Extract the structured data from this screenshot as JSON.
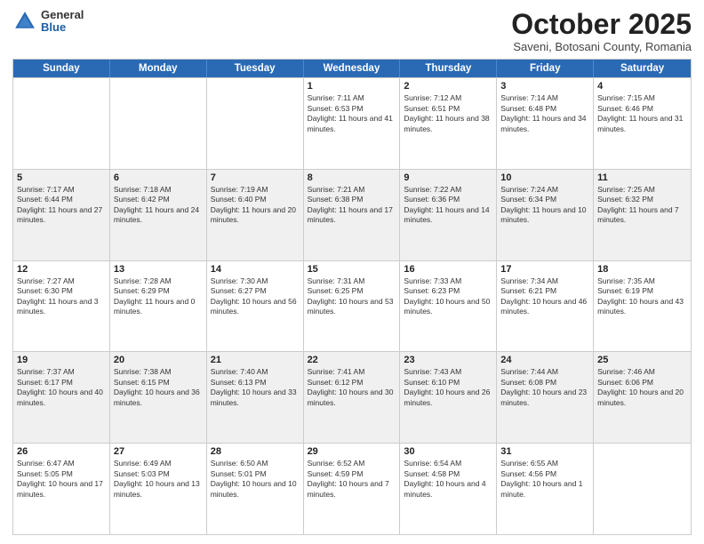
{
  "header": {
    "logo": {
      "general": "General",
      "blue": "Blue"
    },
    "title": "October 2025",
    "location": "Saveni, Botosani County, Romania"
  },
  "weekdays": [
    "Sunday",
    "Monday",
    "Tuesday",
    "Wednesday",
    "Thursday",
    "Friday",
    "Saturday"
  ],
  "rows": [
    [
      {
        "day": "",
        "info": ""
      },
      {
        "day": "",
        "info": ""
      },
      {
        "day": "",
        "info": ""
      },
      {
        "day": "1",
        "info": "Sunrise: 7:11 AM\nSunset: 6:53 PM\nDaylight: 11 hours and 41 minutes."
      },
      {
        "day": "2",
        "info": "Sunrise: 7:12 AM\nSunset: 6:51 PM\nDaylight: 11 hours and 38 minutes."
      },
      {
        "day": "3",
        "info": "Sunrise: 7:14 AM\nSunset: 6:48 PM\nDaylight: 11 hours and 34 minutes."
      },
      {
        "day": "4",
        "info": "Sunrise: 7:15 AM\nSunset: 6:46 PM\nDaylight: 11 hours and 31 minutes."
      }
    ],
    [
      {
        "day": "5",
        "info": "Sunrise: 7:17 AM\nSunset: 6:44 PM\nDaylight: 11 hours and 27 minutes."
      },
      {
        "day": "6",
        "info": "Sunrise: 7:18 AM\nSunset: 6:42 PM\nDaylight: 11 hours and 24 minutes."
      },
      {
        "day": "7",
        "info": "Sunrise: 7:19 AM\nSunset: 6:40 PM\nDaylight: 11 hours and 20 minutes."
      },
      {
        "day": "8",
        "info": "Sunrise: 7:21 AM\nSunset: 6:38 PM\nDaylight: 11 hours and 17 minutes."
      },
      {
        "day": "9",
        "info": "Sunrise: 7:22 AM\nSunset: 6:36 PM\nDaylight: 11 hours and 14 minutes."
      },
      {
        "day": "10",
        "info": "Sunrise: 7:24 AM\nSunset: 6:34 PM\nDaylight: 11 hours and 10 minutes."
      },
      {
        "day": "11",
        "info": "Sunrise: 7:25 AM\nSunset: 6:32 PM\nDaylight: 11 hours and 7 minutes."
      }
    ],
    [
      {
        "day": "12",
        "info": "Sunrise: 7:27 AM\nSunset: 6:30 PM\nDaylight: 11 hours and 3 minutes."
      },
      {
        "day": "13",
        "info": "Sunrise: 7:28 AM\nSunset: 6:29 PM\nDaylight: 11 hours and 0 minutes."
      },
      {
        "day": "14",
        "info": "Sunrise: 7:30 AM\nSunset: 6:27 PM\nDaylight: 10 hours and 56 minutes."
      },
      {
        "day": "15",
        "info": "Sunrise: 7:31 AM\nSunset: 6:25 PM\nDaylight: 10 hours and 53 minutes."
      },
      {
        "day": "16",
        "info": "Sunrise: 7:33 AM\nSunset: 6:23 PM\nDaylight: 10 hours and 50 minutes."
      },
      {
        "day": "17",
        "info": "Sunrise: 7:34 AM\nSunset: 6:21 PM\nDaylight: 10 hours and 46 minutes."
      },
      {
        "day": "18",
        "info": "Sunrise: 7:35 AM\nSunset: 6:19 PM\nDaylight: 10 hours and 43 minutes."
      }
    ],
    [
      {
        "day": "19",
        "info": "Sunrise: 7:37 AM\nSunset: 6:17 PM\nDaylight: 10 hours and 40 minutes."
      },
      {
        "day": "20",
        "info": "Sunrise: 7:38 AM\nSunset: 6:15 PM\nDaylight: 10 hours and 36 minutes."
      },
      {
        "day": "21",
        "info": "Sunrise: 7:40 AM\nSunset: 6:13 PM\nDaylight: 10 hours and 33 minutes."
      },
      {
        "day": "22",
        "info": "Sunrise: 7:41 AM\nSunset: 6:12 PM\nDaylight: 10 hours and 30 minutes."
      },
      {
        "day": "23",
        "info": "Sunrise: 7:43 AM\nSunset: 6:10 PM\nDaylight: 10 hours and 26 minutes."
      },
      {
        "day": "24",
        "info": "Sunrise: 7:44 AM\nSunset: 6:08 PM\nDaylight: 10 hours and 23 minutes."
      },
      {
        "day": "25",
        "info": "Sunrise: 7:46 AM\nSunset: 6:06 PM\nDaylight: 10 hours and 20 minutes."
      }
    ],
    [
      {
        "day": "26",
        "info": "Sunrise: 6:47 AM\nSunset: 5:05 PM\nDaylight: 10 hours and 17 minutes."
      },
      {
        "day": "27",
        "info": "Sunrise: 6:49 AM\nSunset: 5:03 PM\nDaylight: 10 hours and 13 minutes."
      },
      {
        "day": "28",
        "info": "Sunrise: 6:50 AM\nSunset: 5:01 PM\nDaylight: 10 hours and 10 minutes."
      },
      {
        "day": "29",
        "info": "Sunrise: 6:52 AM\nSunset: 4:59 PM\nDaylight: 10 hours and 7 minutes."
      },
      {
        "day": "30",
        "info": "Sunrise: 6:54 AM\nSunset: 4:58 PM\nDaylight: 10 hours and 4 minutes."
      },
      {
        "day": "31",
        "info": "Sunrise: 6:55 AM\nSunset: 4:56 PM\nDaylight: 10 hours and 1 minute."
      },
      {
        "day": "",
        "info": ""
      }
    ]
  ]
}
